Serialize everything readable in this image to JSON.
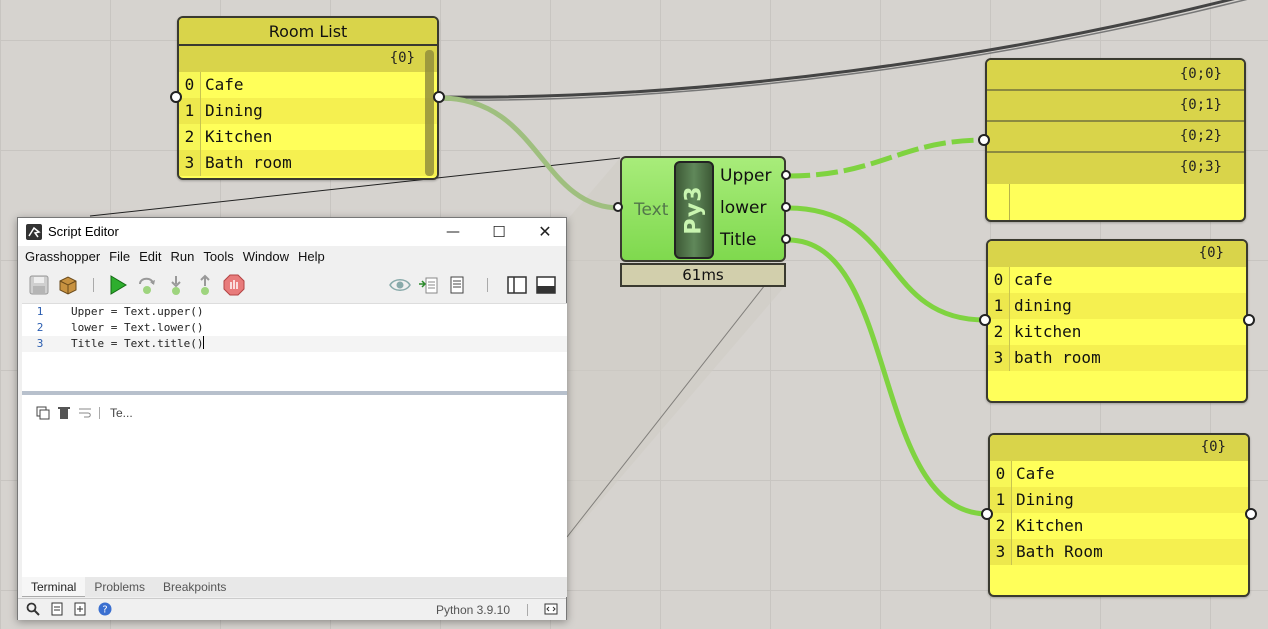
{
  "room_list": {
    "title": "Room List",
    "path": "{0}",
    "items": [
      {
        "index": "0",
        "value": "Cafe"
      },
      {
        "index": "1",
        "value": "Dining"
      },
      {
        "index": "2",
        "value": "Kitchen"
      },
      {
        "index": "3",
        "value": "Bath room"
      }
    ]
  },
  "upper_panel": {
    "paths": [
      "{0;0}",
      "{0;1}",
      "{0;2}",
      "{0;3}"
    ]
  },
  "lower_panel": {
    "path": "{0}",
    "items": [
      {
        "index": "0",
        "value": "cafe"
      },
      {
        "index": "1",
        "value": "dining"
      },
      {
        "index": "2",
        "value": "kitchen"
      },
      {
        "index": "3",
        "value": "bath room"
      }
    ]
  },
  "title_panel": {
    "path": "{0}",
    "items": [
      {
        "index": "0",
        "value": "Cafe"
      },
      {
        "index": "1",
        "value": "Dining"
      },
      {
        "index": "2",
        "value": "Kitchen"
      },
      {
        "index": "3",
        "value": "Bath Room"
      }
    ]
  },
  "python_component": {
    "input": "Text",
    "badge": "Py3",
    "outputs": [
      "Upper",
      "lower",
      "Title"
    ],
    "timing": "61ms"
  },
  "editor": {
    "title": "Script Editor",
    "window_buttons": {
      "minimize": "—",
      "maximize": "☐",
      "close": "✕"
    },
    "menu": [
      "Grasshopper",
      "File",
      "Edit",
      "Run",
      "Tools",
      "Window",
      "Help"
    ],
    "code_lines": [
      {
        "num": "1",
        "text": "Upper = Text.upper()"
      },
      {
        "num": "2",
        "text": "lower = Text.lower()"
      },
      {
        "num": "3",
        "text": "Title = Text.title()"
      }
    ],
    "terminal_label": "Te...",
    "tabs": [
      "Terminal",
      "Problems",
      "Breakpoints"
    ],
    "python_version": "Python 3.9.10"
  },
  "colors": {
    "panel_yellow": "#ffff5a",
    "panel_header": "#d9d44a",
    "component_green": "#8ee05c",
    "wire_green": "#7fd340",
    "wire_dark": "#3a3a3a"
  },
  "icons": {
    "save": "save-icon",
    "package": "package-icon",
    "run": "play-icon",
    "step_over": "step-over-icon",
    "step_into": "step-into-icon",
    "step_out": "step-out-icon",
    "stop": "stop-icon",
    "watch": "eye-icon",
    "search": "search-icon",
    "help": "help-icon"
  }
}
